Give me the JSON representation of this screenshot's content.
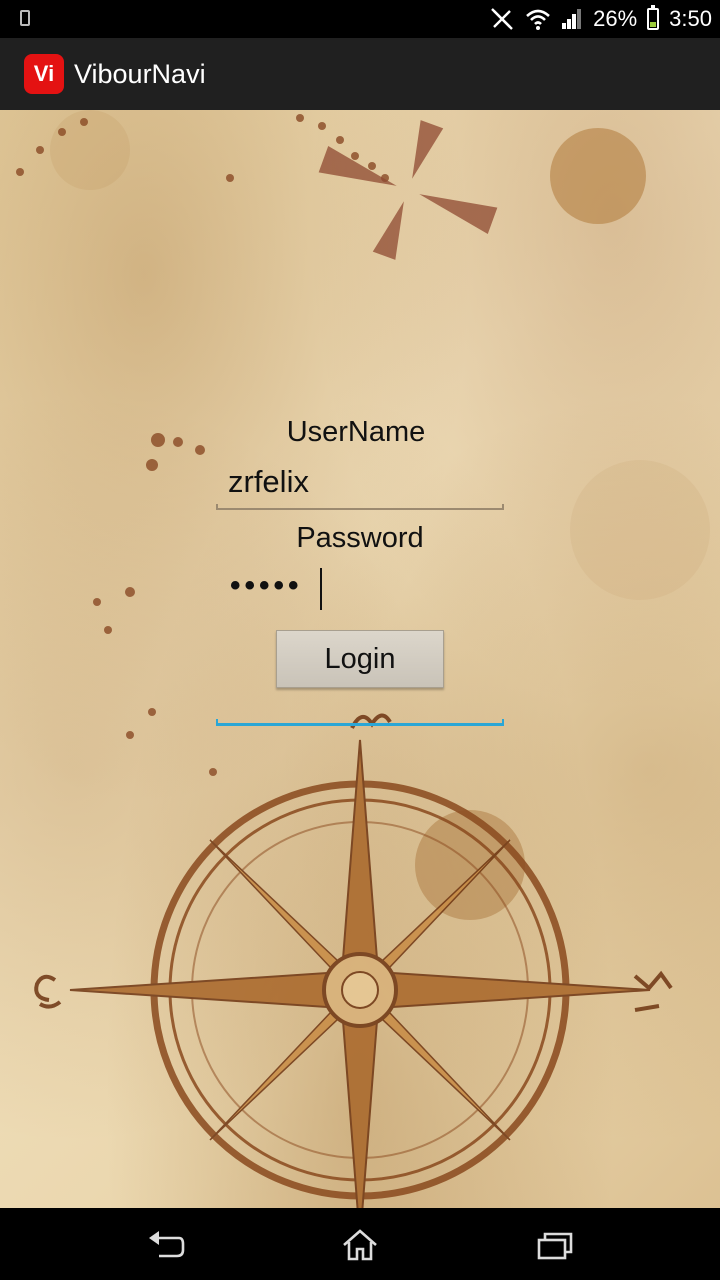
{
  "status_bar": {
    "battery_percent": "26%",
    "time": "3:50",
    "battery_level": 0.26
  },
  "action_bar": {
    "app_icon_text": "Vi",
    "title": "VibourNavi"
  },
  "login_form": {
    "username_label": "UserName",
    "username_value": "zrfelix",
    "password_label": "Password",
    "password_value": "•••••",
    "login_label": "Login"
  },
  "colors": {
    "accent": "#2aa6d6",
    "app_icon": "#e41212",
    "action_bar": "#202020"
  },
  "nav_bar": {
    "icons": [
      "back-icon",
      "home-icon",
      "recent-apps-icon"
    ]
  }
}
